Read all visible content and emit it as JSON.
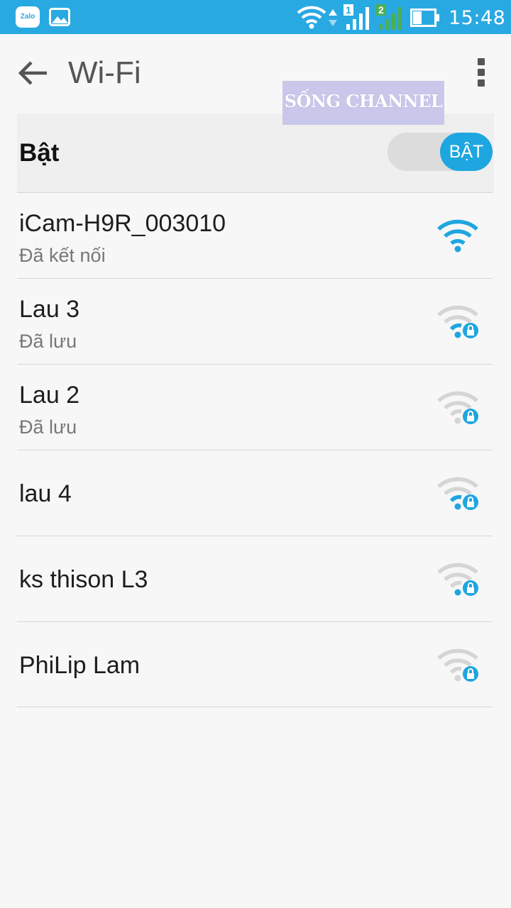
{
  "status_bar": {
    "app_icons": [
      "zalo-icon",
      "gallery-icon"
    ],
    "zalo_text": "Zalo",
    "sim1": "1",
    "sim2": "2",
    "time": "15:48",
    "bar_color": "#29a9e1"
  },
  "header": {
    "title": "Wi-Fi"
  },
  "watermark": "SỐNG CHANNEL",
  "wifi_toggle": {
    "label": "Bật",
    "state": "BẬT",
    "accent": "#1ea6e0"
  },
  "networks": [
    {
      "name": "iCam-H9R_003010",
      "status": "Đã kết nối",
      "secured": false,
      "connected": true
    },
    {
      "name": "Lau 3",
      "status": "Đã lưu",
      "secured": true,
      "connected": false
    },
    {
      "name": "Lau 2",
      "status": "Đã lưu",
      "secured": true,
      "connected": false
    },
    {
      "name": "lau 4",
      "status": "",
      "secured": true,
      "connected": false
    },
    {
      "name": "ks thison L3",
      "status": "",
      "secured": true,
      "connected": false
    },
    {
      "name": "PhiLip Lam",
      "status": "",
      "secured": true,
      "connected": false
    }
  ]
}
